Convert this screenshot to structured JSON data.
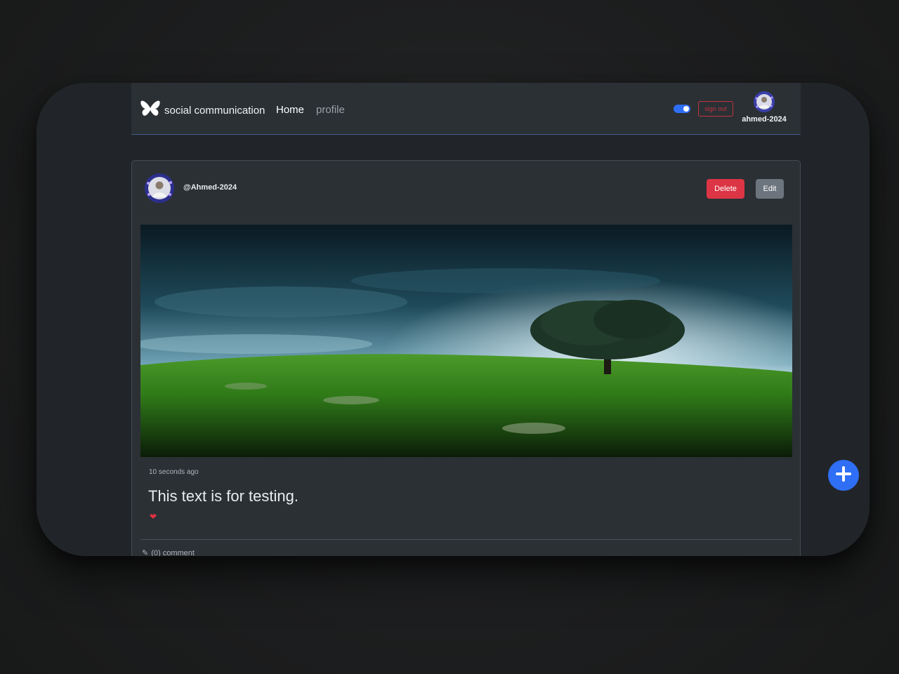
{
  "navbar": {
    "brand": "social communication",
    "links": [
      {
        "label": "Home"
      },
      {
        "label": "profile"
      }
    ],
    "signout_label": "sign out",
    "username": "ahmed-2024",
    "theme_toggle_on": true
  },
  "post": {
    "author": "@Ahmed-2024",
    "delete_label": "Delete",
    "edit_label": "Edit",
    "timestamp": "10 seconds ago",
    "text": "This text is for testing.",
    "comment_label": "(0) comment"
  },
  "colors": {
    "accent": "#2f6ff5",
    "danger": "#dc3545",
    "secondary": "#6c757d",
    "surface": "#2b3035",
    "background": "#212529"
  },
  "icons": {
    "brand": "butterfly-icon",
    "like": "heart-icon",
    "comment": "pencil-icon",
    "add": "plus-icon"
  }
}
